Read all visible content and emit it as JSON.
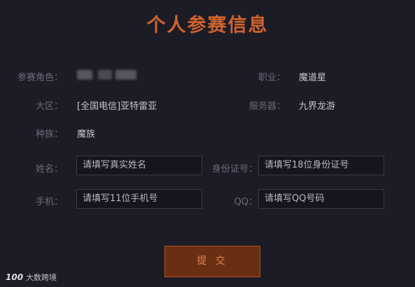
{
  "page_title": "个人参赛信息",
  "info": {
    "role_label": "参赛角色：",
    "job_label": "职业：",
    "job_value": "魔道星",
    "region_label": "大区：",
    "region_value": "[全国电信]亚特雷亚",
    "server_label": "服务器：",
    "server_value": "九界龙游",
    "race_label": "种族：",
    "race_value": "魔族"
  },
  "form": {
    "name_label": "姓名：",
    "name_placeholder": "请填写真实姓名",
    "id_label": "身份证号：",
    "id_placeholder": "请填写18位身份证号",
    "phone_label": "手机：",
    "phone_placeholder": "请填写11位手机号",
    "qq_label": "QQ：",
    "qq_placeholder": "请填写QQ号码"
  },
  "submit_label": "提 交",
  "watermark": {
    "mark": "100",
    "text": "大数跨境"
  }
}
